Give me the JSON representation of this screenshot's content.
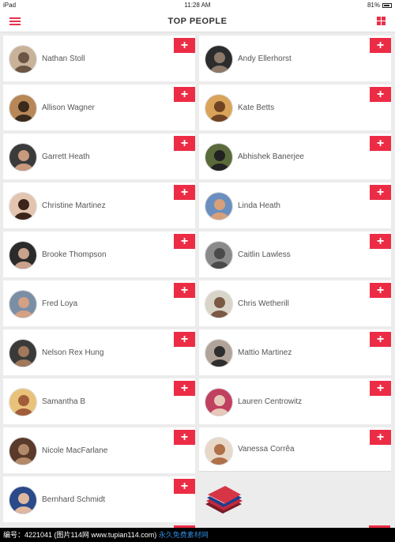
{
  "status_bar": {
    "device": "iPad",
    "time": "11:28 AM",
    "battery": "81%"
  },
  "nav": {
    "title": "TOP PEOPLE",
    "menu_icon": "hamburger-icon",
    "grid_icon": "grid-view-icon"
  },
  "colors": {
    "accent": "#ec2c45",
    "background": "#ececec",
    "card": "#ffffff",
    "text": "#555555"
  },
  "add_button_label": "+",
  "people": [
    {
      "name": "Nathan Stoll"
    },
    {
      "name": "Andy Ellerhorst"
    },
    {
      "name": "Allison Wagner"
    },
    {
      "name": "Kate Betts"
    },
    {
      "name": "Garrett Heath"
    },
    {
      "name": "Abhishek Banerjee"
    },
    {
      "name": "Christine Martinez"
    },
    {
      "name": "Linda Heath"
    },
    {
      "name": "Brooke Thompson"
    },
    {
      "name": "Caitlin Lawless"
    },
    {
      "name": "Fred Loya"
    },
    {
      "name": "Chris Wetherill"
    },
    {
      "name": "Nelson Rex Hung"
    },
    {
      "name": "Mattio Martinez"
    },
    {
      "name": "Samantha B"
    },
    {
      "name": "Lauren Centrowitz"
    },
    {
      "name": "Nicole MacFarlane"
    },
    {
      "name": "Vanessa Corrêa"
    },
    {
      "name": "Bernhard Schmidt"
    }
  ],
  "watermark": {
    "id_text": "编号：4221041 (图片114网 www.tupian114.com)",
    "free_text": "永久免费素材网"
  }
}
